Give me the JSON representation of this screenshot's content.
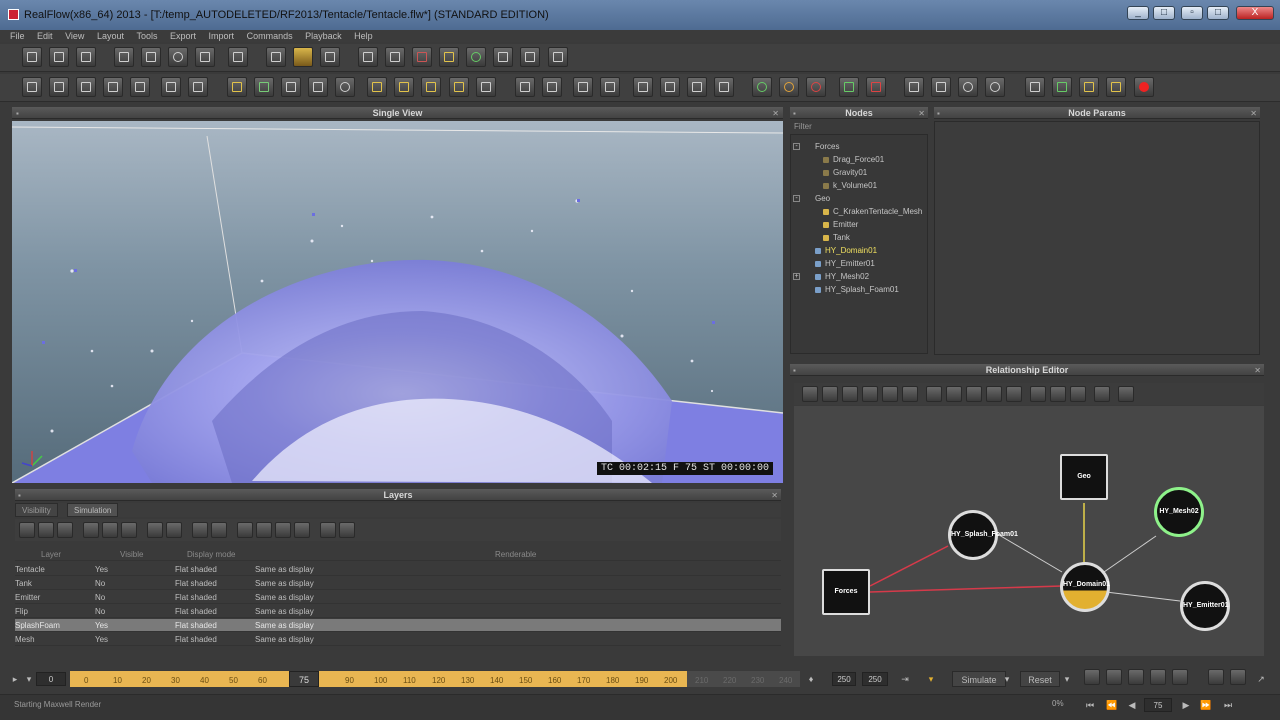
{
  "window": {
    "title": "RealFlow(x86_64) 2013 - [T:/temp_AUTODELETED/RF2013/Tentacle/Tentacle.flw*] (STANDARD EDITION)",
    "min": "_",
    "max": "□",
    "close": "X"
  },
  "menu": [
    "File",
    "Edit",
    "View",
    "Layout",
    "Tools",
    "Export",
    "Import",
    "Commands",
    "Playback",
    "Help"
  ],
  "viewport": {
    "title": "Single View",
    "hud": "TC 00:02:15    F 75    ST 00:00:00"
  },
  "nodes": {
    "title": "Nodes",
    "filter": "Filter",
    "tree": [
      {
        "label": "Forces",
        "level": 0,
        "expander": "-",
        "color": ""
      },
      {
        "label": "Drag_Force01",
        "level": 1,
        "expander": "",
        "color": "#8a7a4a"
      },
      {
        "label": "Gravity01",
        "level": 1,
        "expander": "",
        "color": "#8a7a4a"
      },
      {
        "label": "k_Volume01",
        "level": 1,
        "expander": "",
        "color": "#8a7a4a"
      },
      {
        "label": "Geo",
        "level": 0,
        "expander": "-",
        "color": ""
      },
      {
        "label": "C_KrakenTentacle_Mesh",
        "level": 1,
        "expander": "",
        "color": "#d9b64a"
      },
      {
        "label": "Emitter",
        "level": 1,
        "expander": "",
        "color": "#d9b64a"
      },
      {
        "label": "Tank",
        "level": 1,
        "expander": "",
        "color": "#d9b64a"
      },
      {
        "label": "HY_Domain01",
        "level": 0,
        "expander": "",
        "color": "#7a9fc9",
        "highlight": true
      },
      {
        "label": "HY_Emitter01",
        "level": 0,
        "expander": "",
        "color": "#7a9fc9"
      },
      {
        "label": "HY_Mesh02",
        "level": 0,
        "expander": "+",
        "color": "#7a9fc9"
      },
      {
        "label": "HY_Splash_Foam01",
        "level": 0,
        "expander": "",
        "color": "#7a9fc9"
      }
    ]
  },
  "node_params": {
    "title": "Node Params"
  },
  "relationship_editor": {
    "title": "Relationship Editor",
    "nodes": {
      "geo": "Geo",
      "forces": "Forces",
      "splash": "HY_Splash_Foam01",
      "domain": "HY_Domain01",
      "mesh": "HY_Mesh02",
      "emitter": "HY_Emitter01"
    }
  },
  "layers": {
    "title": "Layers",
    "tabs": [
      "Visibility",
      "Simulation"
    ],
    "columns": [
      "Layer",
      "Visible",
      "Display mode",
      "Renderable"
    ],
    "rows": [
      {
        "layer": "Tentacle",
        "visible": "Yes",
        "display": "Flat shaded",
        "render": "Same as display"
      },
      {
        "layer": "Tank",
        "visible": "No",
        "display": "Flat shaded",
        "render": "Same as display"
      },
      {
        "layer": "Emitter",
        "visible": "No",
        "display": "Flat shaded",
        "render": "Same as display"
      },
      {
        "layer": "Flip",
        "visible": "No",
        "display": "Flat shaded",
        "render": "Same as display"
      },
      {
        "layer": "SplashFoam",
        "visible": "Yes",
        "display": "Flat shaded",
        "render": "Same as display",
        "selected": true
      },
      {
        "layer": "Mesh",
        "visible": "Yes",
        "display": "Flat shaded",
        "render": "Same as display"
      }
    ]
  },
  "timeline": {
    "start": "0",
    "current": "75",
    "ticks": [
      "0",
      "10",
      "20",
      "30",
      "40",
      "50",
      "60",
      "90",
      "100",
      "110",
      "120",
      "130",
      "140",
      "150",
      "160",
      "170",
      "180",
      "190",
      "200"
    ],
    "dim_ticks": [
      "210",
      "220",
      "230",
      "240"
    ],
    "end_a": "250",
    "end_b": "250",
    "simulate": "Simulate",
    "reset": "Reset"
  },
  "status": {
    "message": "Starting Maxwell Render",
    "percent": "0%",
    "frame": "75"
  }
}
